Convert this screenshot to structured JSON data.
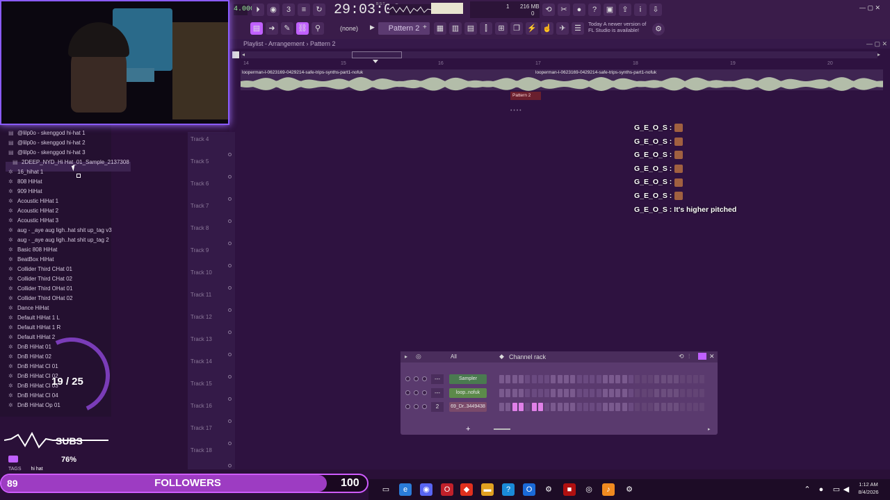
{
  "toolbar": {
    "tempo": "4.000",
    "time": "29:03:06",
    "time_sub": "B:S:T",
    "cpu_line1": "1",
    "cpu_line2": "216 MB",
    "cpu_line3": "0",
    "pattern": "Pattern 2",
    "none_select": "(none)",
    "news_line1": "Today  A newer version of",
    "news_line2": "FL Studio is available!"
  },
  "playlist": {
    "breadcrumb": "Playlist - Arrangement › Pattern 2",
    "clip_name": "looperman-l-0623169-0429214-safe-trips-synths-part1-nofuk",
    "clip_name_2": "looperman-l-0623169-0429214-safe-trips-synths-part1-nofuk",
    "pattern_clip": "Pattern 2",
    "ruler": [
      "14",
      "15",
      "16",
      "17",
      "18",
      "19",
      "20"
    ],
    "tracks": [
      "Track 4",
      "Track 5",
      "Track 6",
      "Track 7",
      "Track 8",
      "Track 9",
      "Track 10",
      "Track 11",
      "Track 12",
      "Track 13",
      "Track 14",
      "Track 15",
      "Track 16",
      "Track 17",
      "Track 18"
    ]
  },
  "browser": {
    "items": [
      "@lilp0o - skenggod hi-hat 1",
      "@lilp0o - skenggod hi-hat 2",
      "@lilp0o - skenggod hi-hat 3",
      "2DEEP_NYD_Hi Hat_01_Sample_2137308",
      "16_hihat 1",
      "808 HiHat",
      "909 HiHat",
      "Acoustic HiHat 1",
      "Acoustic HiHat 2",
      "Acoustic HiHat 3",
      "aug - _aye aug ligh..hat shit up_tag v3",
      "aug - _aye aug ligh..hat shit up_tag 2",
      "Basic 808 HiHat",
      "BeatBox HiHat",
      "Collider Third CHat 01",
      "Collider Third CHat 02",
      "Collider Third OHat 01",
      "Collider Third OHat 02",
      "Dance HiHat",
      "Default HiHat 1 L",
      "Default HiHat 1 R",
      "Default HiHat 2",
      "DnB HiHat 01",
      "DnB HiHat 02",
      "DnB HiHat Cl 01",
      "DnB HiHat Cl 02",
      "DnB HiHat Cl 03",
      "DnB HiHat Cl 04",
      "DnB HiHat Op 01"
    ],
    "tags_label": "TAGS",
    "tags_value": "hi hat"
  },
  "chat": [
    {
      "user": "G_E_O_S :",
      "msg": ""
    },
    {
      "user": "G_E_O_S :",
      "msg": ""
    },
    {
      "user": "G_E_O_S :",
      "msg": ""
    },
    {
      "user": "G_E_O_S :",
      "msg": ""
    },
    {
      "user": "G_E_O_S :",
      "msg": ""
    },
    {
      "user": "G_E_O_S :",
      "msg": ""
    },
    {
      "user": "G_E_O_S :",
      "msg": "It's higher pitched"
    }
  ],
  "rack": {
    "filter": "All",
    "title": "Channel rack",
    "channels": [
      {
        "num": "---",
        "name": "Sampler"
      },
      {
        "num": "---",
        "name": "loop..nofuk"
      },
      {
        "num": "2",
        "name": "69_Dr..3449438"
      }
    ]
  },
  "overlay": {
    "sub_goal": "19 / 25",
    "subs_label": "SUBS",
    "volume": "76%",
    "followers_current": "89",
    "followers_label": "FOLLOWERS",
    "followers_goal": "100",
    "followers_progress": 0.89
  },
  "taskbar": {
    "time": "1:12 AM",
    "date": "8/4/2026"
  }
}
